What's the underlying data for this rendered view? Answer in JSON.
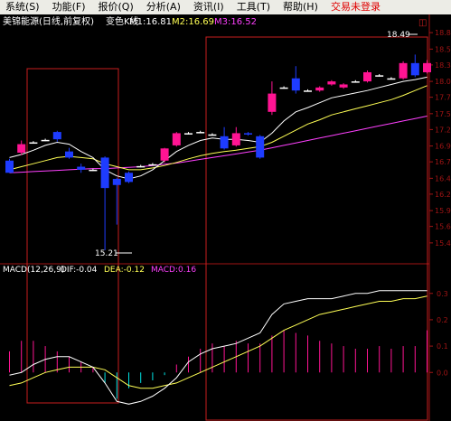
{
  "menu": {
    "items": [
      "系统(S)",
      "功能(F)",
      "报价(Q)",
      "分析(A)",
      "资讯(I)",
      "工具(T)",
      "帮助(H)"
    ],
    "login_label": "交易未登录"
  },
  "header": {
    "stock_name": "美锦能源(日线,前复权)",
    "mode_label": "变色K线",
    "ma1": "M1:16.81",
    "ma2": "M2:16.69",
    "ma3": "M3:16.52",
    "pin_icon": "pin-icon"
  },
  "price_axis": {
    "ticks": [
      "18.85",
      "18.58",
      "18.32",
      "18.05",
      "17.79",
      "17.52",
      "17.26",
      "16.99",
      "16.73",
      "16.46",
      "16.20",
      "15.93",
      "15.67",
      "15.40"
    ]
  },
  "annotations": {
    "high_label": "18.49",
    "low_label": "15.21"
  },
  "macd": {
    "label": "MACD(12,26,9)",
    "dif": "DIF:-0.04",
    "dea": "DEA:-0.12",
    "macd": "MACD:0.16",
    "ticks": [
      "0.3",
      "0.2",
      "0.1",
      "0.0"
    ]
  },
  "colors": {
    "up": "#ff1493",
    "down": "#1e3cff",
    "neutral": "#ffffff",
    "ma1": "#ffffff",
    "ma2": "#ffff55",
    "ma3": "#ff40ff",
    "box": "#c81e1e",
    "axis": "#a01414",
    "text_cyan": "#00e5e5"
  },
  "chart_data": {
    "type": "candlestick",
    "price_candles": [
      {
        "o": 16.75,
        "c": 16.55,
        "h": 16.78,
        "l": 16.55
      },
      {
        "o": 16.88,
        "c": 17.02,
        "h": 17.08,
        "l": 16.84
      },
      {
        "o": 17.05,
        "c": 17.05,
        "h": 17.07,
        "l": 17.03
      },
      {
        "o": 17.09,
        "c": 17.09,
        "h": 17.11,
        "l": 17.07
      },
      {
        "o": 17.22,
        "c": 17.1,
        "h": 17.24,
        "l": 17.06
      },
      {
        "o": 16.9,
        "c": 16.8,
        "h": 16.96,
        "l": 16.78
      },
      {
        "o": 16.65,
        "c": 16.6,
        "h": 16.7,
        "l": 16.55
      },
      {
        "o": 16.6,
        "c": 16.6,
        "h": 16.62,
        "l": 16.58
      },
      {
        "o": 16.8,
        "c": 16.3,
        "h": 16.82,
        "l": 15.28
      },
      {
        "o": 16.45,
        "c": 16.35,
        "h": 16.47,
        "l": 15.7
      },
      {
        "o": 16.55,
        "c": 16.4,
        "h": 16.57,
        "l": 16.38
      },
      {
        "o": 16.66,
        "c": 16.66,
        "h": 16.68,
        "l": 16.64
      },
      {
        "o": 16.69,
        "c": 16.69,
        "h": 16.71,
        "l": 16.67
      },
      {
        "o": 16.75,
        "c": 16.95,
        "h": 16.96,
        "l": 16.72
      },
      {
        "o": 17.0,
        "c": 17.2,
        "h": 17.22,
        "l": 16.98
      },
      {
        "o": 17.2,
        "c": 17.2,
        "h": 17.22,
        "l": 17.18
      },
      {
        "o": 17.22,
        "c": 17.22,
        "h": 17.24,
        "l": 17.2
      },
      {
        "o": 17.18,
        "c": 17.18,
        "h": 17.2,
        "l": 17.16
      },
      {
        "o": 17.15,
        "c": 16.95,
        "h": 17.3,
        "l": 16.93
      },
      {
        "o": 17.0,
        "c": 17.2,
        "h": 17.3,
        "l": 16.98
      },
      {
        "o": 17.2,
        "c": 17.18,
        "h": 17.22,
        "l": 17.16
      },
      {
        "o": 17.15,
        "c": 16.8,
        "h": 17.17,
        "l": 16.78
      },
      {
        "o": 17.55,
        "c": 17.85,
        "h": 18.05,
        "l": 17.5
      },
      {
        "o": 17.95,
        "c": 17.95,
        "h": 17.97,
        "l": 17.93
      },
      {
        "o": 18.1,
        "c": 17.9,
        "h": 18.3,
        "l": 17.85
      },
      {
        "o": 17.9,
        "c": 17.9,
        "h": 17.92,
        "l": 17.88
      },
      {
        "o": 17.9,
        "c": 17.95,
        "h": 17.97,
        "l": 17.88
      },
      {
        "o": 18.0,
        "c": 18.05,
        "h": 18.07,
        "l": 17.98
      },
      {
        "o": 17.95,
        "c": 18.0,
        "h": 18.02,
        "l": 17.93
      },
      {
        "o": 18.05,
        "c": 18.05,
        "h": 18.07,
        "l": 18.03
      },
      {
        "o": 18.05,
        "c": 18.2,
        "h": 18.23,
        "l": 18.03
      },
      {
        "o": 18.15,
        "c": 18.15,
        "h": 18.17,
        "l": 18.13
      },
      {
        "o": 18.1,
        "c": 18.1,
        "h": 18.12,
        "l": 18.08
      },
      {
        "o": 18.1,
        "c": 18.35,
        "h": 18.38,
        "l": 18.08
      },
      {
        "o": 18.35,
        "c": 18.15,
        "h": 18.49,
        "l": 18.12
      },
      {
        "o": 18.2,
        "c": 18.35,
        "h": 18.4,
        "l": 18.18
      }
    ],
    "ma1": [
      16.8,
      16.85,
      16.92,
      17.0,
      17.05,
      17.02,
      16.9,
      16.8,
      16.6,
      16.5,
      16.45,
      16.5,
      16.6,
      16.75,
      16.9,
      17.0,
      17.08,
      17.12,
      17.1,
      17.1,
      17.08,
      17.05,
      17.2,
      17.4,
      17.55,
      17.62,
      17.7,
      17.78,
      17.82,
      17.86,
      17.9,
      17.95,
      18.0,
      18.05,
      18.08,
      18.12
    ],
    "ma2": [
      16.6,
      16.65,
      16.7,
      16.75,
      16.8,
      16.82,
      16.8,
      16.78,
      16.7,
      16.65,
      16.6,
      16.6,
      16.63,
      16.67,
      16.72,
      16.78,
      16.83,
      16.87,
      16.9,
      16.92,
      16.95,
      16.98,
      17.05,
      17.15,
      17.25,
      17.35,
      17.42,
      17.5,
      17.55,
      17.6,
      17.65,
      17.7,
      17.75,
      17.82,
      17.9,
      17.98
    ],
    "ma3": [
      16.55,
      16.56,
      16.57,
      16.58,
      16.59,
      16.6,
      16.61,
      16.62,
      16.62,
      16.63,
      16.64,
      16.65,
      16.67,
      16.69,
      16.71,
      16.74,
      16.77,
      16.8,
      16.83,
      16.86,
      16.89,
      16.92,
      16.96,
      17.0,
      17.04,
      17.08,
      17.12,
      17.16,
      17.2,
      17.24,
      17.28,
      17.32,
      17.36,
      17.4,
      17.44,
      17.48
    ],
    "macd_hist": [
      0.08,
      0.12,
      0.12,
      0.1,
      0.08,
      0.06,
      0.04,
      0.02,
      -0.04,
      -0.1,
      -0.06,
      -0.04,
      -0.03,
      -0.01,
      0.03,
      0.06,
      0.09,
      0.11,
      0.1,
      0.12,
      0.11,
      0.11,
      0.14,
      0.16,
      0.15,
      0.14,
      0.12,
      0.11,
      0.1,
      0.09,
      0.09,
      0.1,
      0.09,
      0.1,
      0.1,
      0.16
    ],
    "dif": [
      -0.01,
      0.0,
      0.03,
      0.05,
      0.06,
      0.06,
      0.04,
      0.02,
      -0.04,
      -0.11,
      -0.12,
      -0.11,
      -0.09,
      -0.06,
      -0.02,
      0.04,
      0.07,
      0.09,
      0.1,
      0.11,
      0.13,
      0.15,
      0.22,
      0.26,
      0.27,
      0.28,
      0.28,
      0.28,
      0.29,
      0.3,
      0.3,
      0.31,
      0.31,
      0.31,
      0.31,
      0.31
    ],
    "dea": [
      -0.05,
      -0.04,
      -0.02,
      0.0,
      0.01,
      0.02,
      0.02,
      0.02,
      0.01,
      -0.02,
      -0.05,
      -0.06,
      -0.06,
      -0.05,
      -0.04,
      -0.02,
      0.0,
      0.02,
      0.04,
      0.06,
      0.08,
      0.1,
      0.13,
      0.16,
      0.18,
      0.2,
      0.22,
      0.23,
      0.24,
      0.25,
      0.26,
      0.27,
      0.27,
      0.28,
      0.28,
      0.29
    ],
    "price_range": [
      15.22,
      19.0
    ],
    "macd_range": [
      -0.15,
      0.33
    ]
  }
}
